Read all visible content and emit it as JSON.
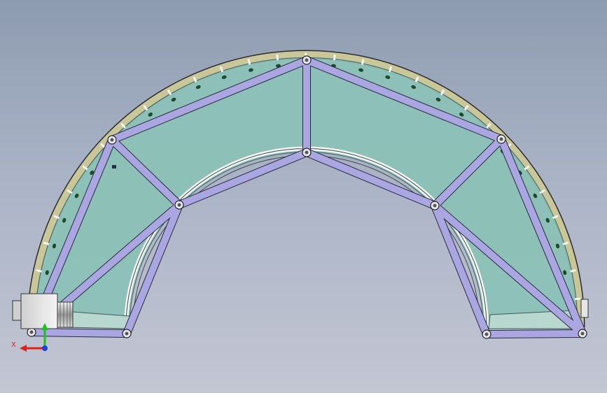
{
  "viewport": {
    "background_top": "#8d9bb0",
    "background_bottom": "#c3c6d3"
  },
  "model": {
    "frame_color": "#a9a6e2",
    "frame_stroke": "#2a2a3a",
    "belt_color": "#8cc2b8",
    "rail_color": "#c9c69a",
    "roller_color": "#1e4a2c",
    "joint_color": "#e6e6ee"
  },
  "triad": {
    "x_label": "X",
    "x_color": "#e0201a",
    "y_color": "#20c020",
    "z_color": "#1f3fe0"
  }
}
